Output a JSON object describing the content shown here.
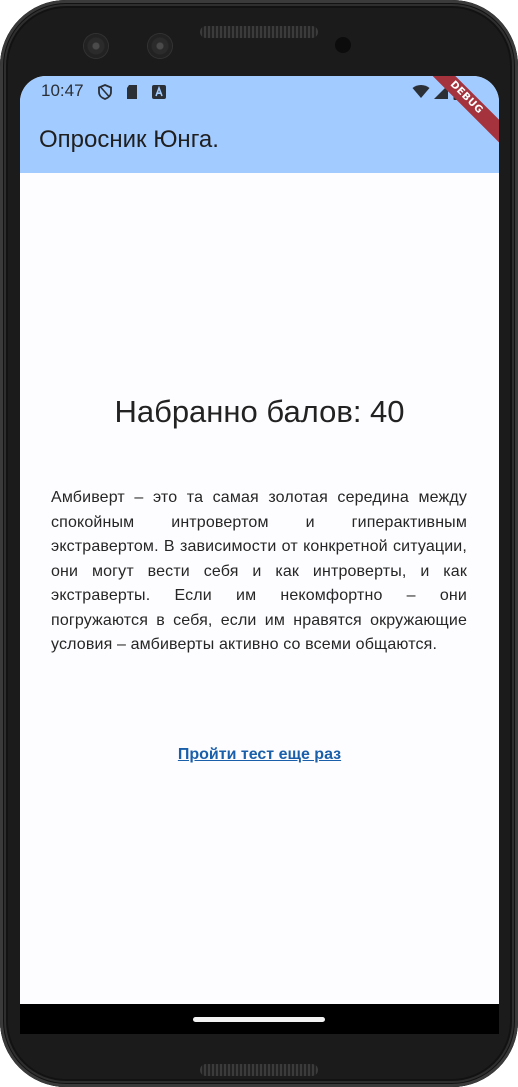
{
  "status_bar": {
    "time": "10:47",
    "icons": [
      "shield-icon",
      "sd-card-icon",
      "keyboard-a-icon",
      "wifi-icon",
      "signal-icon",
      "battery-icon"
    ]
  },
  "debug_banner": "DEBUG",
  "app_bar": {
    "title": "Опросник Юнга.",
    "color": "#a2cbff"
  },
  "result": {
    "score_text": "Набранно балов: 40",
    "description": "Амбиверт – это та самая золотая середина между спокойным интровертом и гиперактивным экстравертом. В зависимости от конкретной ситуации, они могут вести себя и как интроверты, и как экстраверты. Если им некомфортно – они погружаются в себя, если им нравятся окружающие условия – амбиверты активно со всеми общаются.",
    "retry_label": "Пройти тест еще раз",
    "link_color": "#1a5faa"
  }
}
